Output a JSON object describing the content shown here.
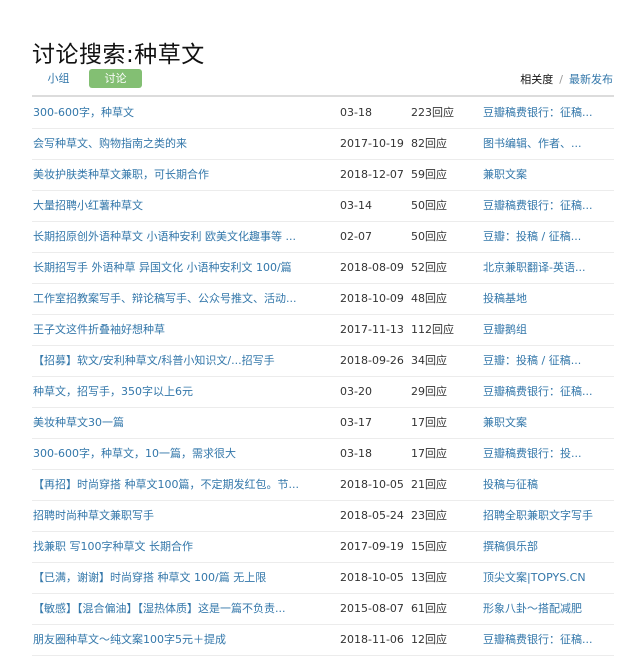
{
  "page": {
    "title": "讨论搜索:种草文"
  },
  "tabs": {
    "group_label": "小组",
    "discussion_label": "讨论"
  },
  "sort": {
    "relevance_label": "相关度",
    "separator": "/",
    "latest_label": "最新发布"
  },
  "colors": {
    "link": "#3377aa",
    "tab_active_bg": "#83bf73",
    "divider": "#ececec"
  },
  "rows": [
    {
      "title": "300-600字，种草文",
      "time": "03-18",
      "count": "223回应",
      "group": "豆瓣稿费银行：征稿..."
    },
    {
      "title": "会写种草文、购物指南之类的来",
      "time": "2017-10-19",
      "count": "82回应",
      "group": "图书编辑、作者、..."
    },
    {
      "title": "美妆护肤类种草文兼职，可长期合作",
      "time": "2018-12-07",
      "count": "59回应",
      "group": "兼职文案"
    },
    {
      "title": "大量招聘小红薯种草文",
      "time": "03-14",
      "count": "50回应",
      "group": "豆瓣稿费银行：征稿..."
    },
    {
      "title": "长期招原创外语种草文 小语种安利 欧美文化趣事等 ...",
      "time": "02-07",
      "count": "50回应",
      "group": "豆瓣：投稿 / 征稿..."
    },
    {
      "title": "长期招写手 外语种草 异国文化 小语种安利文 100/篇",
      "time": "2018-08-09",
      "count": "52回应",
      "group": "北京兼职翻译-英语..."
    },
    {
      "title": "工作室招教案写手、辩论稿写手、公众号推文、活动...",
      "time": "2018-10-09",
      "count": "48回应",
      "group": "投稿基地"
    },
    {
      "title": "王子文这件折叠袖好想种草",
      "time": "2017-11-13",
      "count": "112回应",
      "group": "豆瓣鹅组"
    },
    {
      "title": "【招募】软文/安利种草文/科普小知识文/...招写手",
      "time": "2018-09-26",
      "count": "34回应",
      "group": "豆瓣：投稿 / 征稿..."
    },
    {
      "title": "种草文，招写手，350字以上6元",
      "time": "03-20",
      "count": "29回应",
      "group": "豆瓣稿费银行：征稿..."
    },
    {
      "title": "美妆种草文30一篇",
      "time": "03-17",
      "count": "17回应",
      "group": "兼职文案"
    },
    {
      "title": "300-600字，种草文，10一篇，需求很大",
      "time": "03-18",
      "count": "17回应",
      "group": "豆瓣稿费银行：投..."
    },
    {
      "title": "【再招】时尚穿搭 种草文100篇，不定期发红包。节...",
      "time": "2018-10-05",
      "count": "21回应",
      "group": "投稿与征稿"
    },
    {
      "title": "招聘时尚种草文兼职写手",
      "time": "2018-05-24",
      "count": "23回应",
      "group": "招聘全职兼职文字写手"
    },
    {
      "title": "找兼职 写100字种草文 长期合作",
      "time": "2017-09-19",
      "count": "15回应",
      "group": "撰稿俱乐部"
    },
    {
      "title": "【已满，谢谢】时尚穿搭 种草文 100/篇 无上限",
      "time": "2018-10-05",
      "count": "13回应",
      "group": "顶尖文案|TOPYS.CN"
    },
    {
      "title": "【敏感】【混合偏油】【湿热体质】这是一篇不负责...",
      "time": "2015-08-07",
      "count": "61回应",
      "group": "形象八卦～搭配减肥"
    },
    {
      "title": "朋友圈种草文～纯文案100字5元＋提成",
      "time": "2018-11-06",
      "count": "12回应",
      "group": "豆瓣稿费银行：征稿..."
    }
  ]
}
